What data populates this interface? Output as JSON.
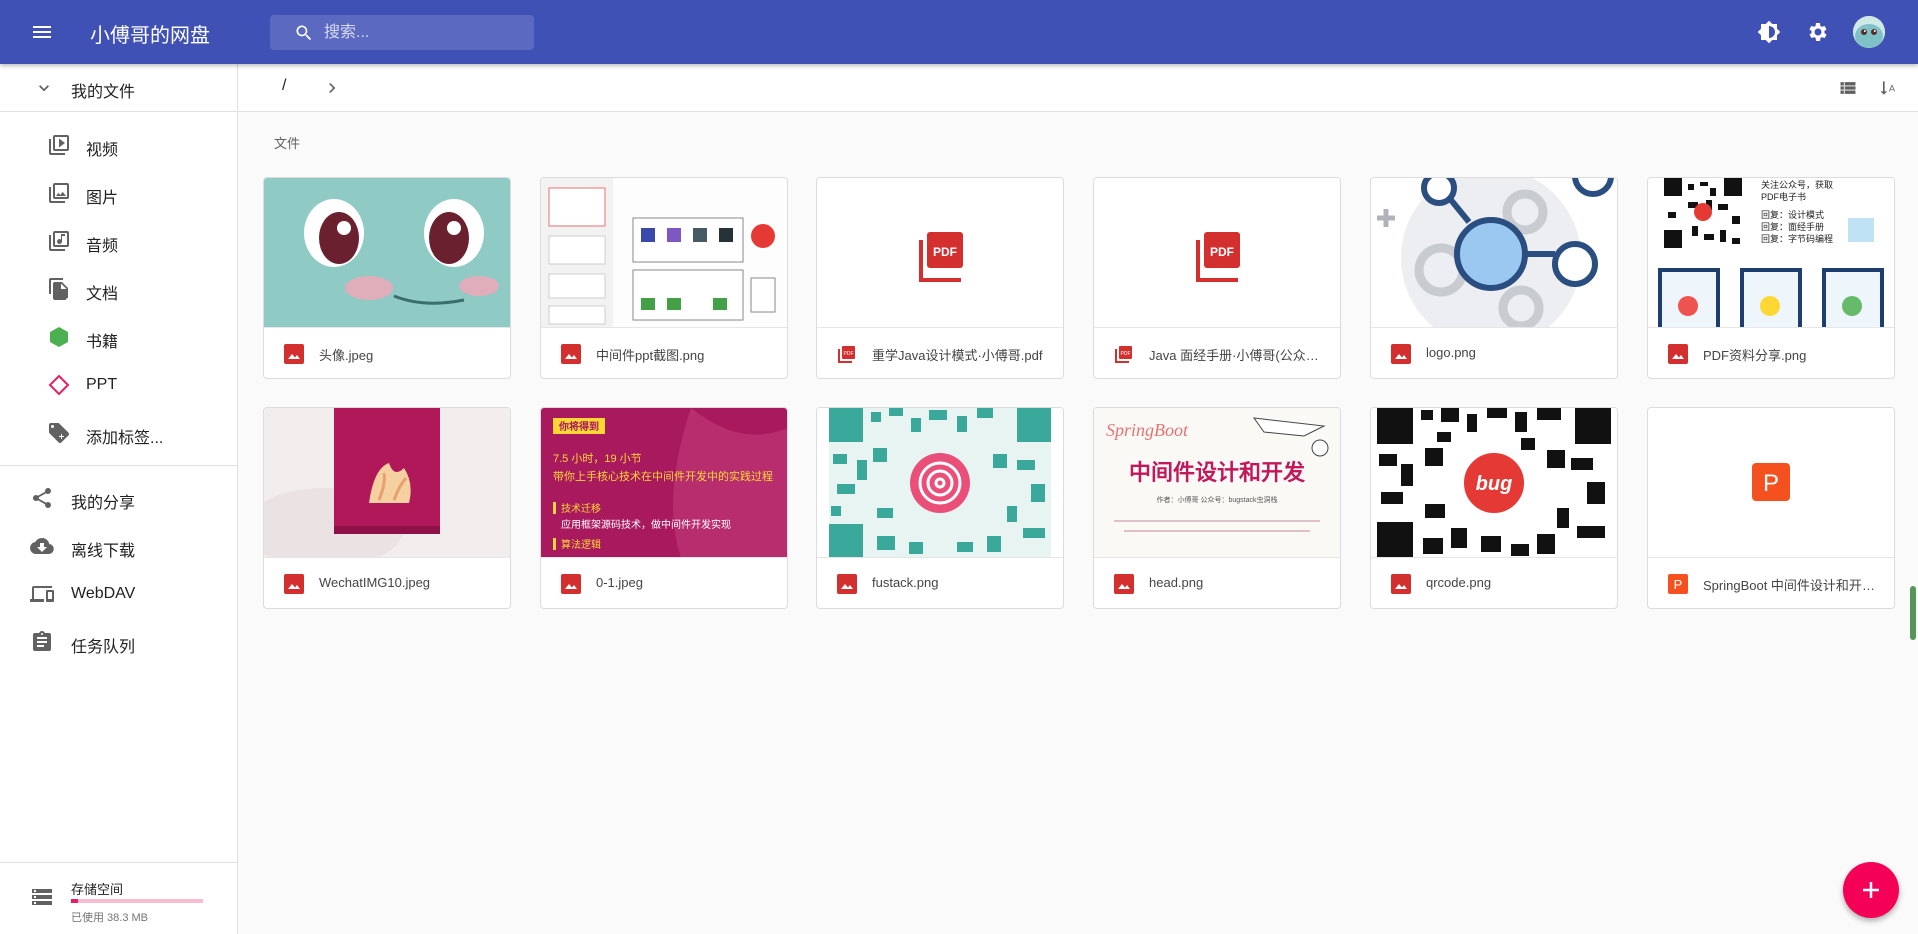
{
  "app": {
    "title": "小傅哥的网盘"
  },
  "search": {
    "placeholder": "搜索..."
  },
  "header": {
    "icons": [
      "menu-icon",
      "search-icon",
      "theme-icon",
      "settings-icon",
      "avatar"
    ]
  },
  "sidebar": {
    "section_title": "我的文件",
    "items": [
      {
        "label": "视频",
        "icon": "video-library-icon"
      },
      {
        "label": "图片",
        "icon": "photo-library-icon"
      },
      {
        "label": "音频",
        "icon": "music-library-icon"
      },
      {
        "label": "文档",
        "icon": "file-copy-icon"
      },
      {
        "label": "书籍",
        "icon": "hexagon-icon",
        "color": "#4caf50"
      },
      {
        "label": "PPT",
        "icon": "diamond-icon",
        "color": "#e91e63"
      },
      {
        "label": "添加标签...",
        "icon": "tag-add-icon"
      }
    ],
    "bottom_items": [
      {
        "label": "我的分享",
        "icon": "share-icon"
      },
      {
        "label": "离线下载",
        "icon": "cloud-download-icon"
      },
      {
        "label": "WebDAV",
        "icon": "devices-icon"
      },
      {
        "label": "任务队列",
        "icon": "clipboard-icon"
      }
    ],
    "storage": {
      "label": "存储空间",
      "used": "已使用 38.3 MB",
      "fraction": 0.05
    }
  },
  "breadcrumb": {
    "root": "/"
  },
  "main": {
    "section_label": "文件",
    "files": [
      {
        "name": "头像.jpeg",
        "type": "image"
      },
      {
        "name": "中间件ppt截图.png",
        "type": "image"
      },
      {
        "name": "重学Java设计模式·小傅哥.pdf",
        "type": "pdf"
      },
      {
        "name": "Java 面经手册·小傅哥(公众号：bugstack虫洞栈).pdf",
        "type": "pdf"
      },
      {
        "name": "logo.png",
        "type": "image"
      },
      {
        "name": "PDF资料分享.png",
        "type": "image"
      },
      {
        "name": "WechatIMG10.jpeg",
        "type": "image"
      },
      {
        "name": "0-1.jpeg",
        "type": "image"
      },
      {
        "name": "fustack.png",
        "type": "image"
      },
      {
        "name": "head.png",
        "type": "image"
      },
      {
        "name": "qrcode.png",
        "type": "image"
      },
      {
        "name": "SpringBoot 中间件设计和开发.pptx",
        "type": "ppt"
      }
    ],
    "thumb_texts": {
      "pdf_badge": "PDF",
      "ppt_badge": "P",
      "bug": "bug",
      "pdf_share_lines": [
        "关注公众号，获取",
        "PDF电子书",
        "回复：设计模式",
        "回复：面经手册",
        "回复：字节码编程"
      ],
      "course_tag": "你将得到",
      "course_line1": "7.5 小时，19 小节",
      "course_line2": "带你上手核心技术在中间件开发中的实践过程",
      "course_line3": "技术迁移",
      "course_line4": "应用框架源码技术，做中间件开发实现",
      "course_line5": "算法逻辑",
      "head_title": "中间件设计和开发",
      "head_brand": "SpringBoot",
      "head_sub": "作者：小傅哥  公众号：bugstack虫洞栈"
    }
  },
  "colors": {
    "primary": "#3f51b5",
    "accent": "#f50057",
    "image_icon": "#d32f2f",
    "ppt_orange": "#f4511e"
  }
}
